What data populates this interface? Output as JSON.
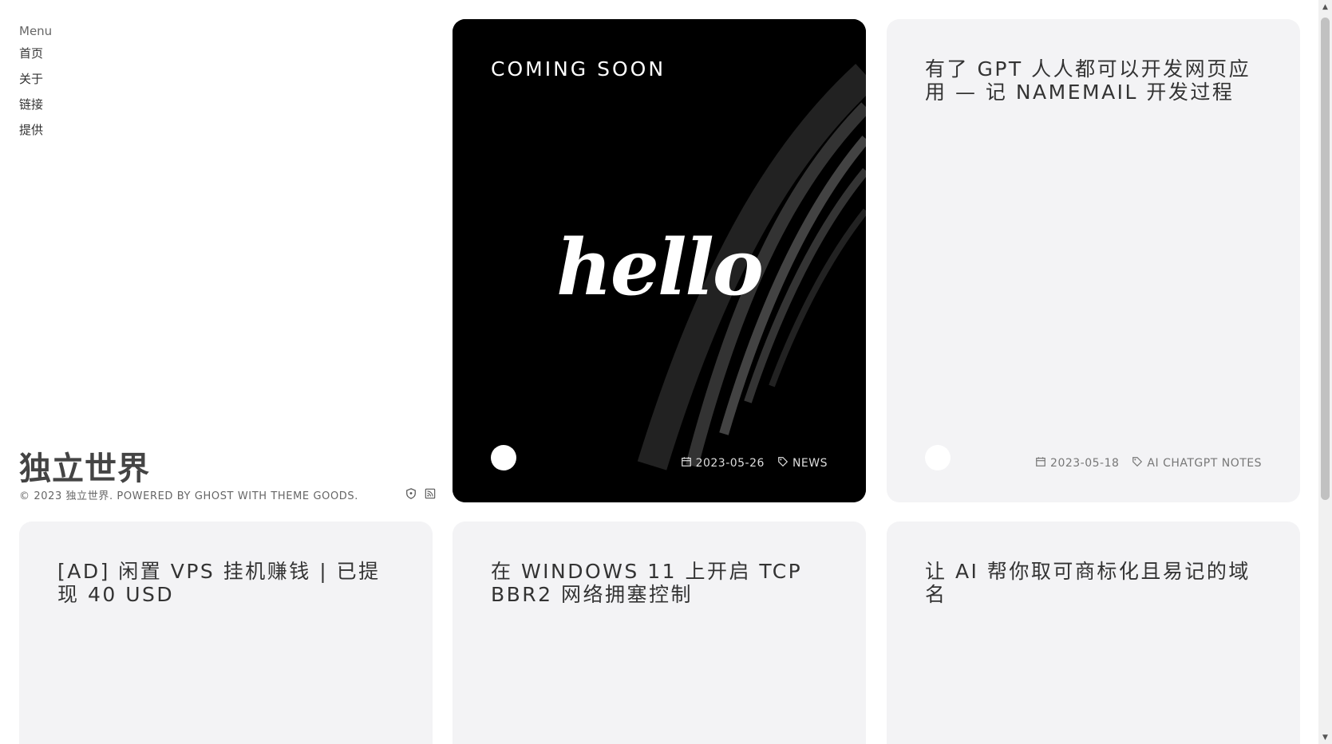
{
  "sidebar": {
    "menu_title": "Menu",
    "items": [
      {
        "label": "首页"
      },
      {
        "label": "关于"
      },
      {
        "label": "链接"
      },
      {
        "label": "提供"
      }
    ],
    "site_title": "独立世界",
    "footer_text": "© 2023 独立世界. POWERED BY GHOST WITH THEME GOODS."
  },
  "posts": [
    {
      "title": "COMING SOON",
      "image_text": "hello",
      "date": "2023-05-26",
      "tags": "NEWS"
    },
    {
      "title": "有了 GPT 人人都可以开发网页应用 — 记 NAMEMAIL 开发过程",
      "date": "2023-05-18",
      "tags": "AI CHATGPT NOTES"
    },
    {
      "title": "[AD] 闲置 VPS 挂机赚钱 | 已提现 40 USD"
    },
    {
      "title": "在 WINDOWS 11 上开启 TCP BBR2 网络拥塞控制"
    },
    {
      "title": "让 AI 帮你取可商标化且易记的域名"
    }
  ],
  "colors": {
    "card_bg": "#f3f3f5",
    "hero_bg": "#000000",
    "text": "#333333"
  },
  "icons": [
    "calendar-icon",
    "tag-icon",
    "shield-icon",
    "rss-icon"
  ]
}
